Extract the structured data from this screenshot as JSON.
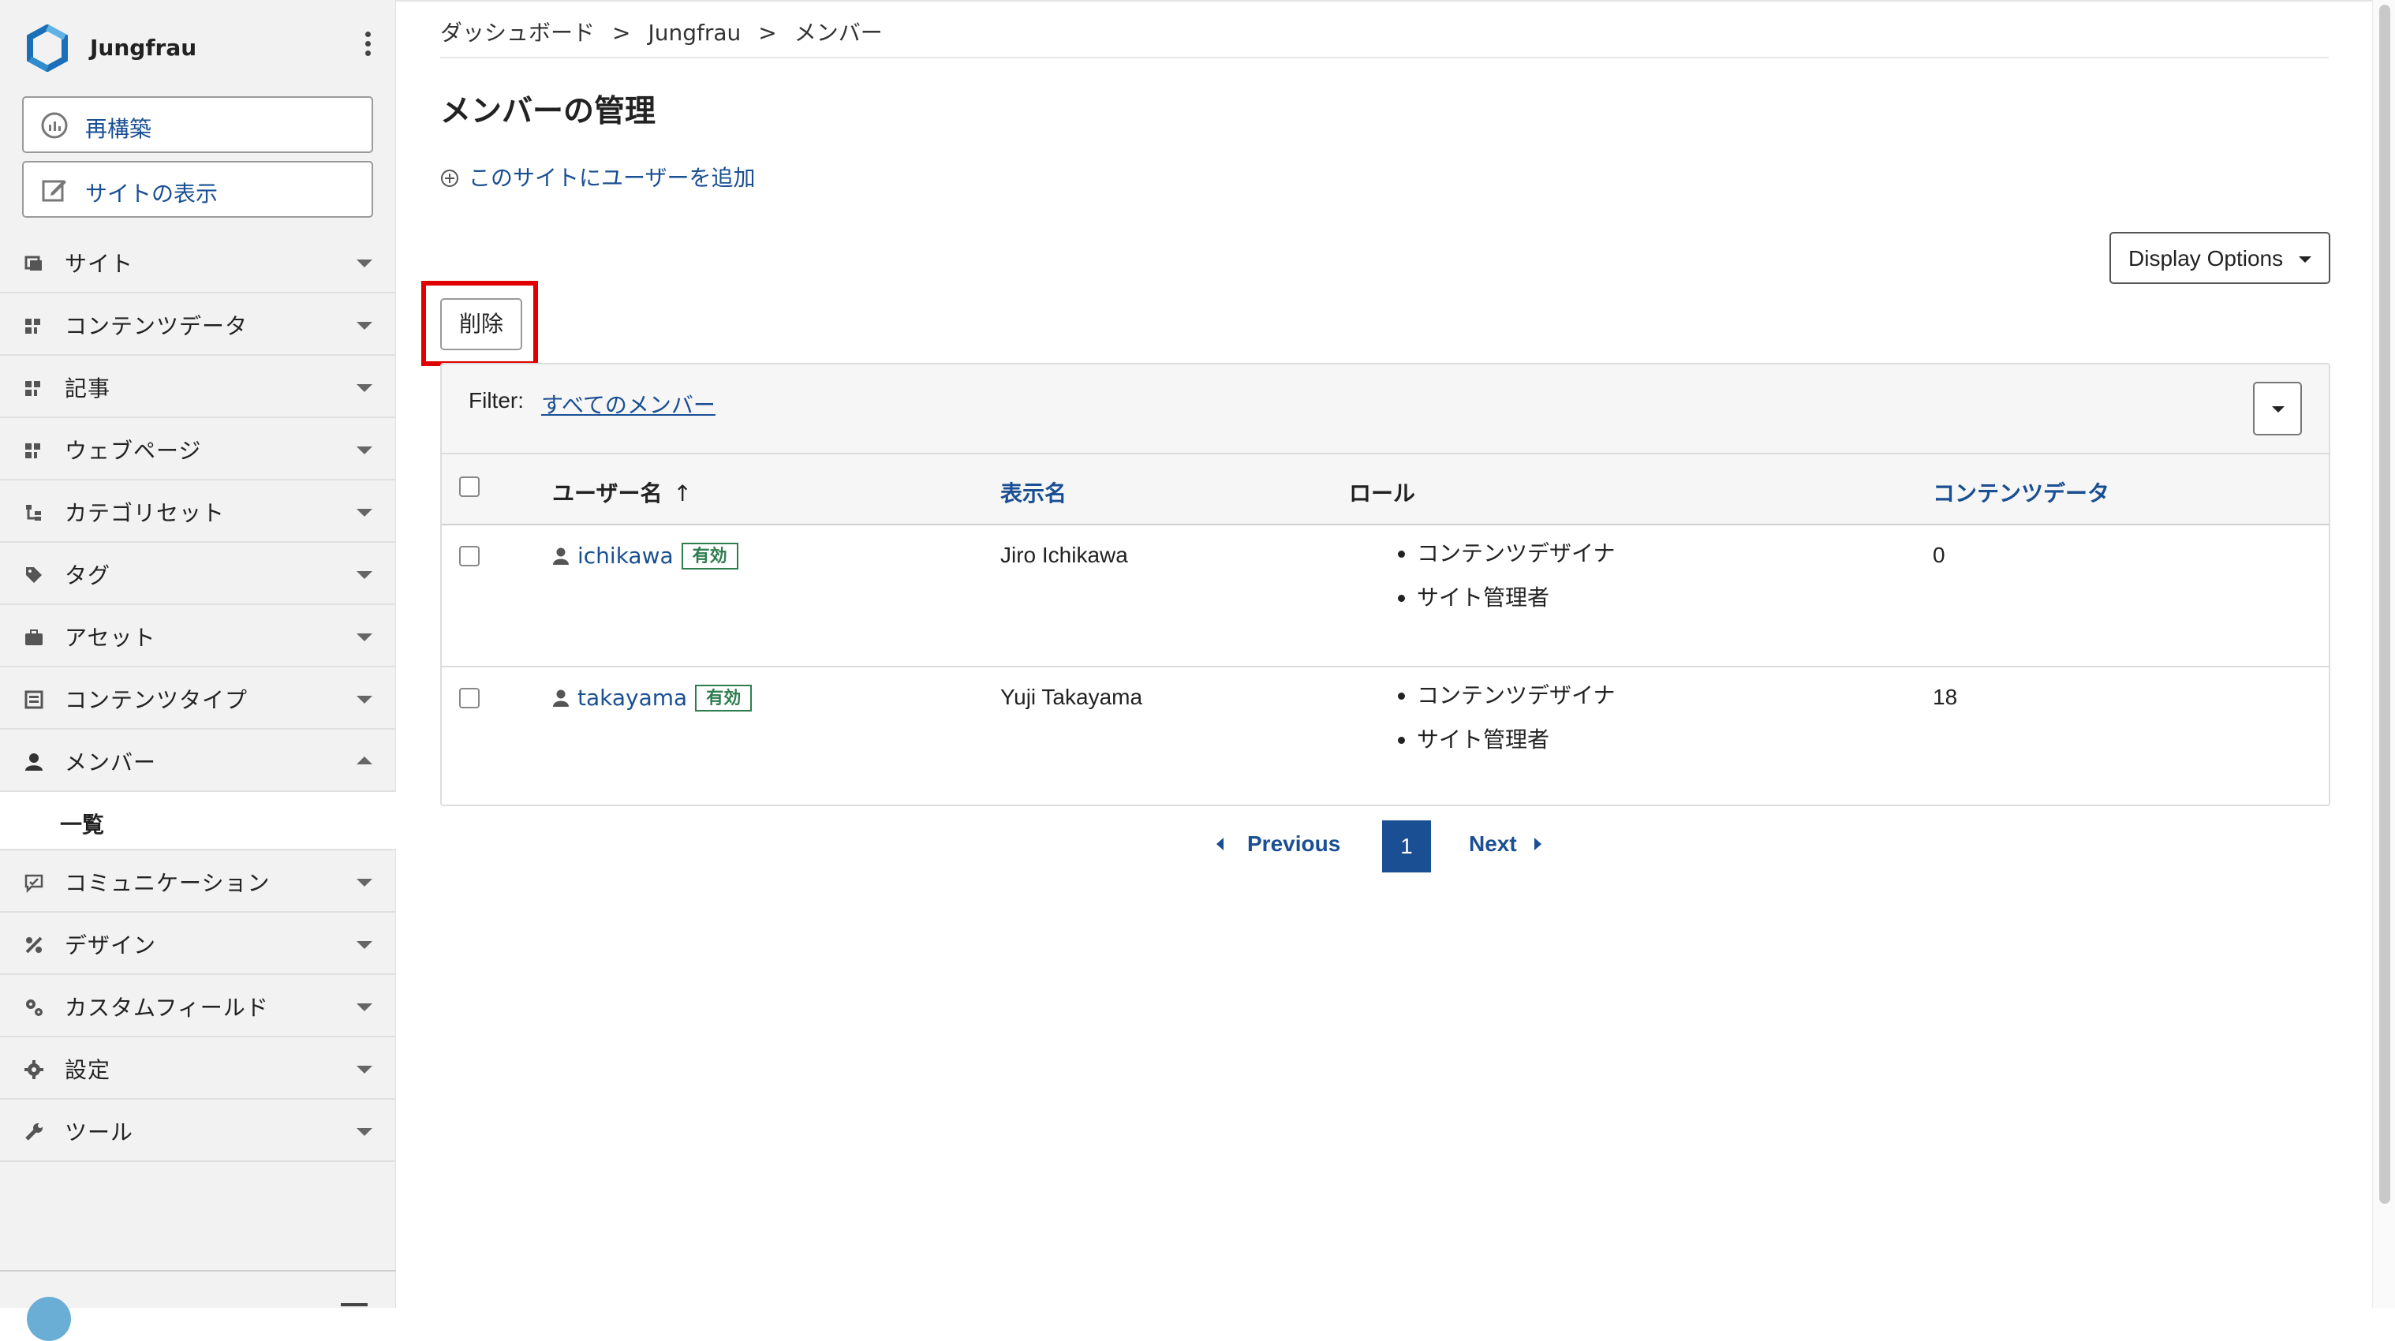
{
  "app": {
    "name": "Jungfrau"
  },
  "sidebar": {
    "buttons": [
      {
        "label": "再構築",
        "icon": "rebuild-gauge-icon"
      },
      {
        "label": "サイトの表示",
        "icon": "edit-square-icon"
      }
    ],
    "items": [
      {
        "label": "サイト",
        "icon": "site-icon",
        "expanded": false
      },
      {
        "label": "コンテンツデータ",
        "icon": "content-data-icon",
        "expanded": false
      },
      {
        "label": "記事",
        "icon": "entry-icon",
        "expanded": false
      },
      {
        "label": "ウェブページ",
        "icon": "webpage-icon",
        "expanded": false
      },
      {
        "label": "カテゴリセット",
        "icon": "category-set-icon",
        "expanded": false
      },
      {
        "label": "タグ",
        "icon": "tag-icon",
        "expanded": false
      },
      {
        "label": "アセット",
        "icon": "asset-briefcase-icon",
        "expanded": false
      },
      {
        "label": "コンテンツタイプ",
        "icon": "content-type-icon",
        "expanded": false
      },
      {
        "label": "メンバー",
        "icon": "member-icon",
        "expanded": true
      },
      {
        "label": "コミュニケーション",
        "icon": "communication-icon",
        "expanded": false
      },
      {
        "label": "デザイン",
        "icon": "design-icon",
        "expanded": false
      },
      {
        "label": "カスタムフィールド",
        "icon": "custom-field-icon",
        "expanded": false
      },
      {
        "label": "設定",
        "icon": "settings-gear-icon",
        "expanded": false
      },
      {
        "label": "ツール",
        "icon": "tools-wrench-icon",
        "expanded": false
      }
    ],
    "sub_item": {
      "label": "一覧"
    }
  },
  "breadcrumb": {
    "items": [
      "ダッシュボード",
      "Jungfrau",
      "メンバー"
    ],
    "separator": ">"
  },
  "page": {
    "title": "メンバーの管理",
    "add_user_label": "このサイトにユーザーを追加",
    "display_options_label": "Display Options",
    "delete_label": "削除"
  },
  "filter": {
    "label": "Filter:",
    "value": "すべてのメンバー"
  },
  "table": {
    "columns": [
      "ユーザー名",
      "表示名",
      "ロール",
      "コンテンツデータ"
    ],
    "sort_indicator": "↑",
    "rows": [
      {
        "username": "ichikawa",
        "status": "有効",
        "display_name": "Jiro Ichikawa",
        "roles": [
          "コンテンツデザイナ",
          "サイト管理者"
        ],
        "content_count": "0"
      },
      {
        "username": "takayama",
        "status": "有効",
        "display_name": "Yuji Takayama",
        "roles": [
          "コンテンツデザイナ",
          "サイト管理者"
        ],
        "content_count": "18"
      }
    ]
  },
  "pagination": {
    "previous": "Previous",
    "current": "1",
    "next": "Next"
  },
  "colors": {
    "link": "#1a4f93",
    "status_active": "#2e7d4f",
    "highlight": "#e00000",
    "sidebar_bg": "#f2f2f2"
  }
}
